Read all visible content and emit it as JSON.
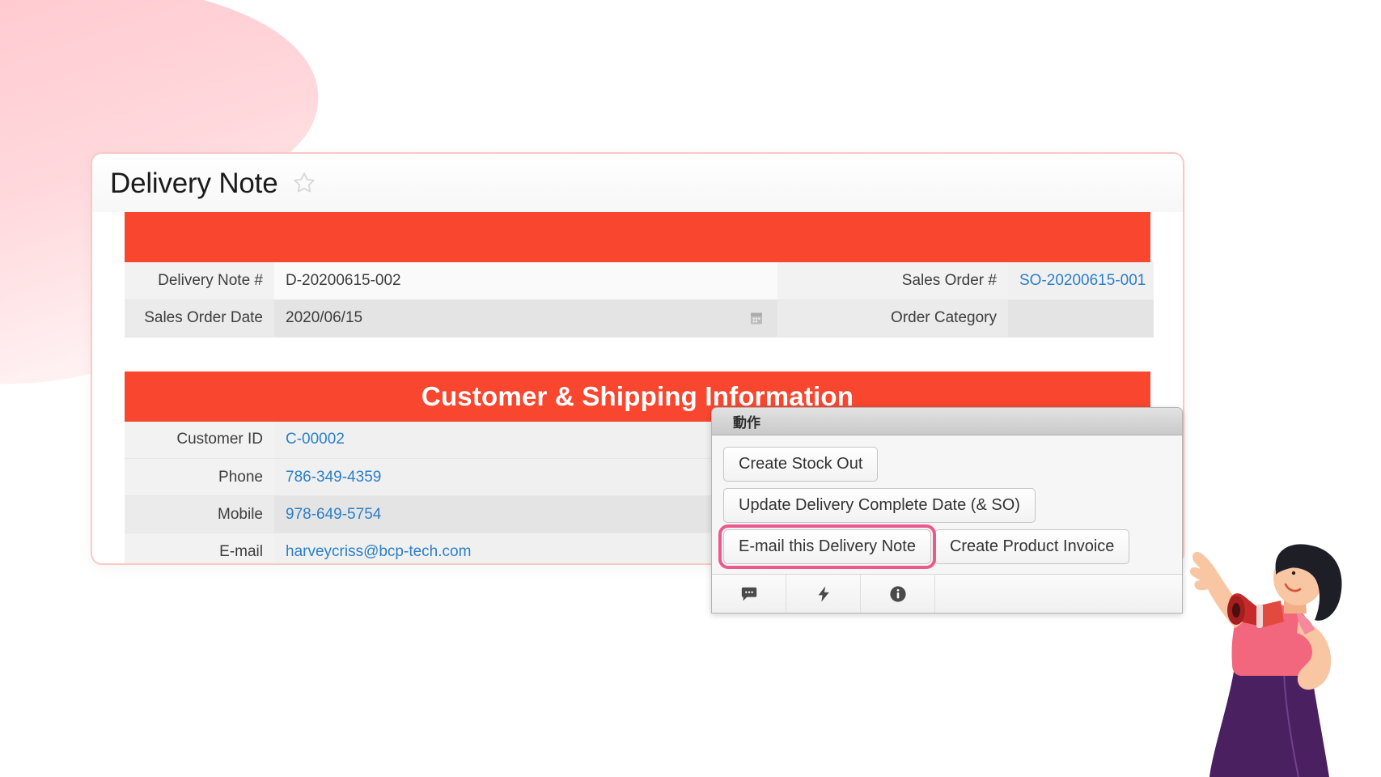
{
  "page": {
    "title": "Delivery Note",
    "star_icon": "star-outline-icon"
  },
  "order_section": {
    "band_title": "",
    "rows": [
      {
        "label_left": "Delivery Note #",
        "value_left": "D-20200615-002",
        "label_right": "Sales Order #",
        "value_right": "SO-20200615-001",
        "value_right_is_link": true
      },
      {
        "label_left": "Sales Order Date",
        "value_left": "2020/06/15",
        "has_calendar_icon": true,
        "calendar_icon": "calendar-icon",
        "label_right": "Order Category",
        "value_right": "",
        "value_right_is_link": false
      }
    ]
  },
  "customer_section": {
    "band_title": "Customer & Shipping Information",
    "rows": [
      {
        "label": "Customer ID",
        "value": "C-00002",
        "is_link": true
      },
      {
        "label": "Phone",
        "value": "786-349-4359",
        "is_link": true
      },
      {
        "label": "Mobile",
        "value": "978-649-5754",
        "is_link": true
      },
      {
        "label": "E-mail",
        "value": "harveycriss@bcp-tech.com",
        "is_link": true
      }
    ]
  },
  "action_popup": {
    "title": "動作",
    "buttons": [
      {
        "label": "Create Stock Out",
        "highlighted": false
      },
      {
        "label": "Update Delivery Complete Date (& SO)",
        "highlighted": false
      },
      {
        "label": "E-mail this Delivery Note",
        "highlighted": true
      },
      {
        "label": "Create Product Invoice",
        "highlighted": false
      }
    ],
    "toolbar_icons": [
      {
        "name": "comment-icon"
      },
      {
        "name": "lightning-bolt-icon"
      },
      {
        "name": "info-icon"
      }
    ]
  },
  "colors": {
    "band_red": "#f9462e",
    "link_blue": "#2a7fc9",
    "highlight_pink": "#eb5a8c",
    "card_border_pink": "#fbc8c3",
    "blob_pink": "#ffd3d8"
  },
  "decorations": {
    "blob": "pink-blob-shape",
    "mascot": "woman-with-megaphone-illustration"
  }
}
